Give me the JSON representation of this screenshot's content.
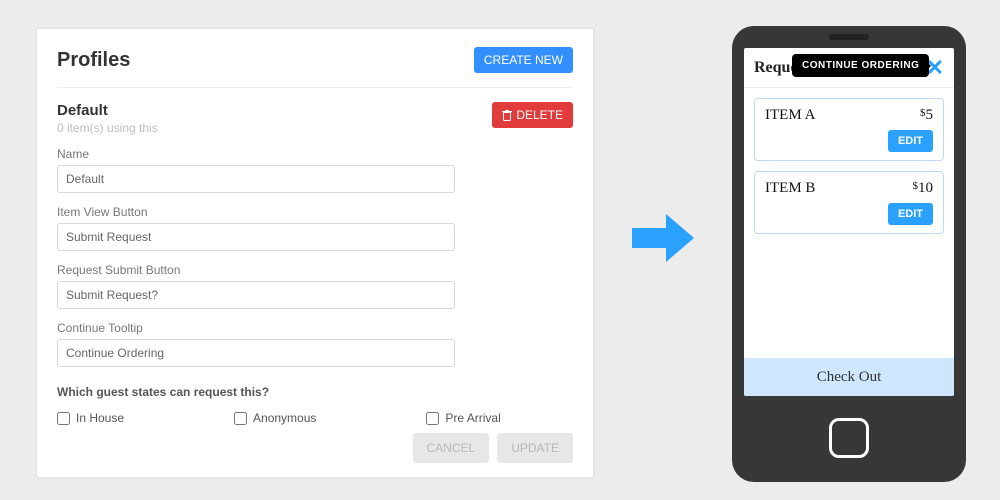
{
  "panel": {
    "title": "Profiles",
    "create_label": "CREATE NEW",
    "section_title": "Default",
    "section_sub": "0 item(s) using this",
    "delete_label": "DELETE",
    "fields": {
      "name_label": "Name",
      "name_value": "Default",
      "item_view_label": "Item View Button",
      "item_view_value": "Submit Request",
      "submit_label": "Request Submit Button",
      "submit_value": "Submit Request?",
      "tooltip_label": "Continue Tooltip",
      "tooltip_value": "Continue Ordering"
    },
    "guest_question": "Which guest states can request this?",
    "guest_options": {
      "in_house": "In House",
      "anonymous": "Anonymous",
      "pre_arrival": "Pre Arrival"
    },
    "cancel_label": "CANCEL",
    "update_label": "UPDATE"
  },
  "phone": {
    "header_title": "Reque",
    "tooltip_text": "CONTINUE ORDERING",
    "items": [
      {
        "name": "ITEM A",
        "price": "5",
        "edit": "EDIT"
      },
      {
        "name": "ITEM B",
        "price": "10",
        "edit": "EDIT"
      }
    ],
    "checkout_label": "Check Out"
  },
  "colors": {
    "primary": "#338fff",
    "danger": "#e23b3b"
  }
}
